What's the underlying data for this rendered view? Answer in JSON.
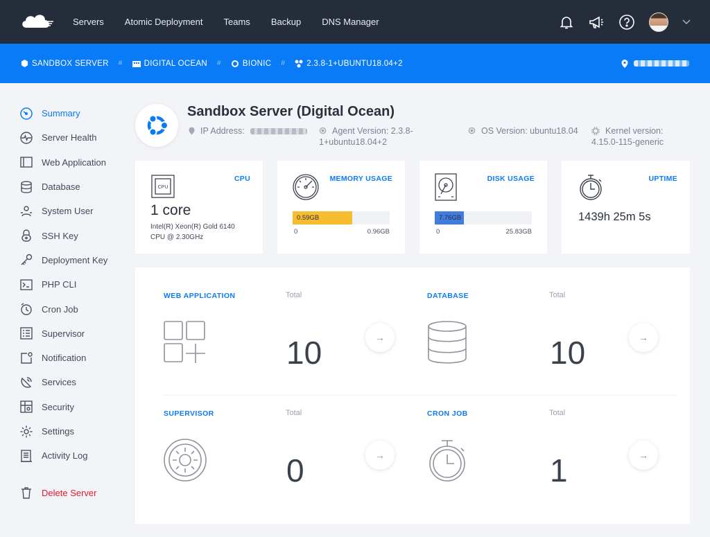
{
  "nav": {
    "links": [
      "Servers",
      "Atomic Deployment",
      "Teams",
      "Backup",
      "DNS Manager"
    ]
  },
  "breadcrumb": {
    "server": "SANDBOX SERVER",
    "provider": "DIGITAL OCEAN",
    "os": "BIONIC",
    "agent": "2.3.8-1+UBUNTU18.04+2"
  },
  "sidebar": {
    "items": [
      "Summary",
      "Server Health",
      "Web Application",
      "Database",
      "System User",
      "SSH Key",
      "Deployment Key",
      "PHP CLI",
      "Cron Job",
      "Supervisor",
      "Notification",
      "Services",
      "Security",
      "Settings",
      "Activity Log"
    ],
    "delete": "Delete Server"
  },
  "server": {
    "title": "Sandbox Server (Digital Ocean)",
    "ip_label": "IP Address:",
    "agent_label": "Agent Version: 2.3.8-",
    "agent_label2": "1+ubuntu18.04+2",
    "os_label": "OS Version: ubuntu18.04",
    "kernel_label": "Kernel version:",
    "kernel_value": "4.15.0-115-generic"
  },
  "cards": {
    "cpu": {
      "title": "CPU",
      "value": "1 core",
      "detail1": "Intel(R) Xeon(R) Gold 6140",
      "detail2": "CPU @ 2.30GHz",
      "icon_text": "CPU"
    },
    "memory": {
      "title": "MEMORY USAGE",
      "used": "0.59GB",
      "min": "0",
      "max": "0.96GB",
      "fraction": 0.614
    },
    "disk": {
      "title": "DISK USAGE",
      "used": "7.76GB",
      "min": "0",
      "max": "25.83GB",
      "fraction": 0.3
    },
    "uptime": {
      "title": "UPTIME",
      "value": "1439h 25m 5s"
    }
  },
  "stats": [
    {
      "title": "WEB APPLICATION",
      "total_label": "Total",
      "value": "10"
    },
    {
      "title": "DATABASE",
      "total_label": "Total",
      "value": "10"
    },
    {
      "title": "SUPERVISOR",
      "total_label": "Total",
      "value": "0"
    },
    {
      "title": "CRON JOB",
      "total_label": "Total",
      "value": "1"
    }
  ],
  "colors": {
    "nav_bg": "#252d3b",
    "accent": "#0a7bf6",
    "memory_bar": "#f7bd31",
    "disk_bar": "#3f7de0",
    "danger": "#e0192b"
  },
  "arrow": "→"
}
